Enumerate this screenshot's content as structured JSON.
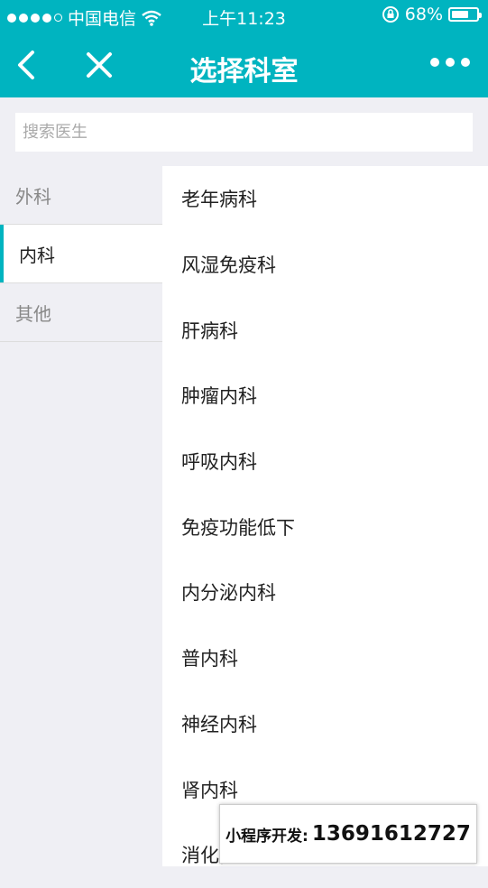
{
  "status_bar": {
    "carrier": "中国电信",
    "time": "上午11:23",
    "battery_text": "68%",
    "battery_level": 0.68,
    "signal_bars": 4
  },
  "nav": {
    "title": "选择科室"
  },
  "search": {
    "placeholder": "搜索医生",
    "value": ""
  },
  "sidebar": {
    "items": [
      {
        "label": "外科",
        "active": false
      },
      {
        "label": "内科",
        "active": true
      },
      {
        "label": "其他",
        "active": false
      }
    ]
  },
  "departments": [
    "老年病科",
    "风湿免疫科",
    "肝病科",
    "肿瘤内科",
    "呼吸内科",
    "免疫功能低下",
    "内分泌内科",
    "普内科",
    "神经内科",
    "肾内科",
    "消化内科"
  ],
  "promo": {
    "label": "小程序开发:",
    "phone": "13691612727"
  },
  "colors": {
    "accent": "#00b4c0",
    "background": "#efeff4"
  }
}
